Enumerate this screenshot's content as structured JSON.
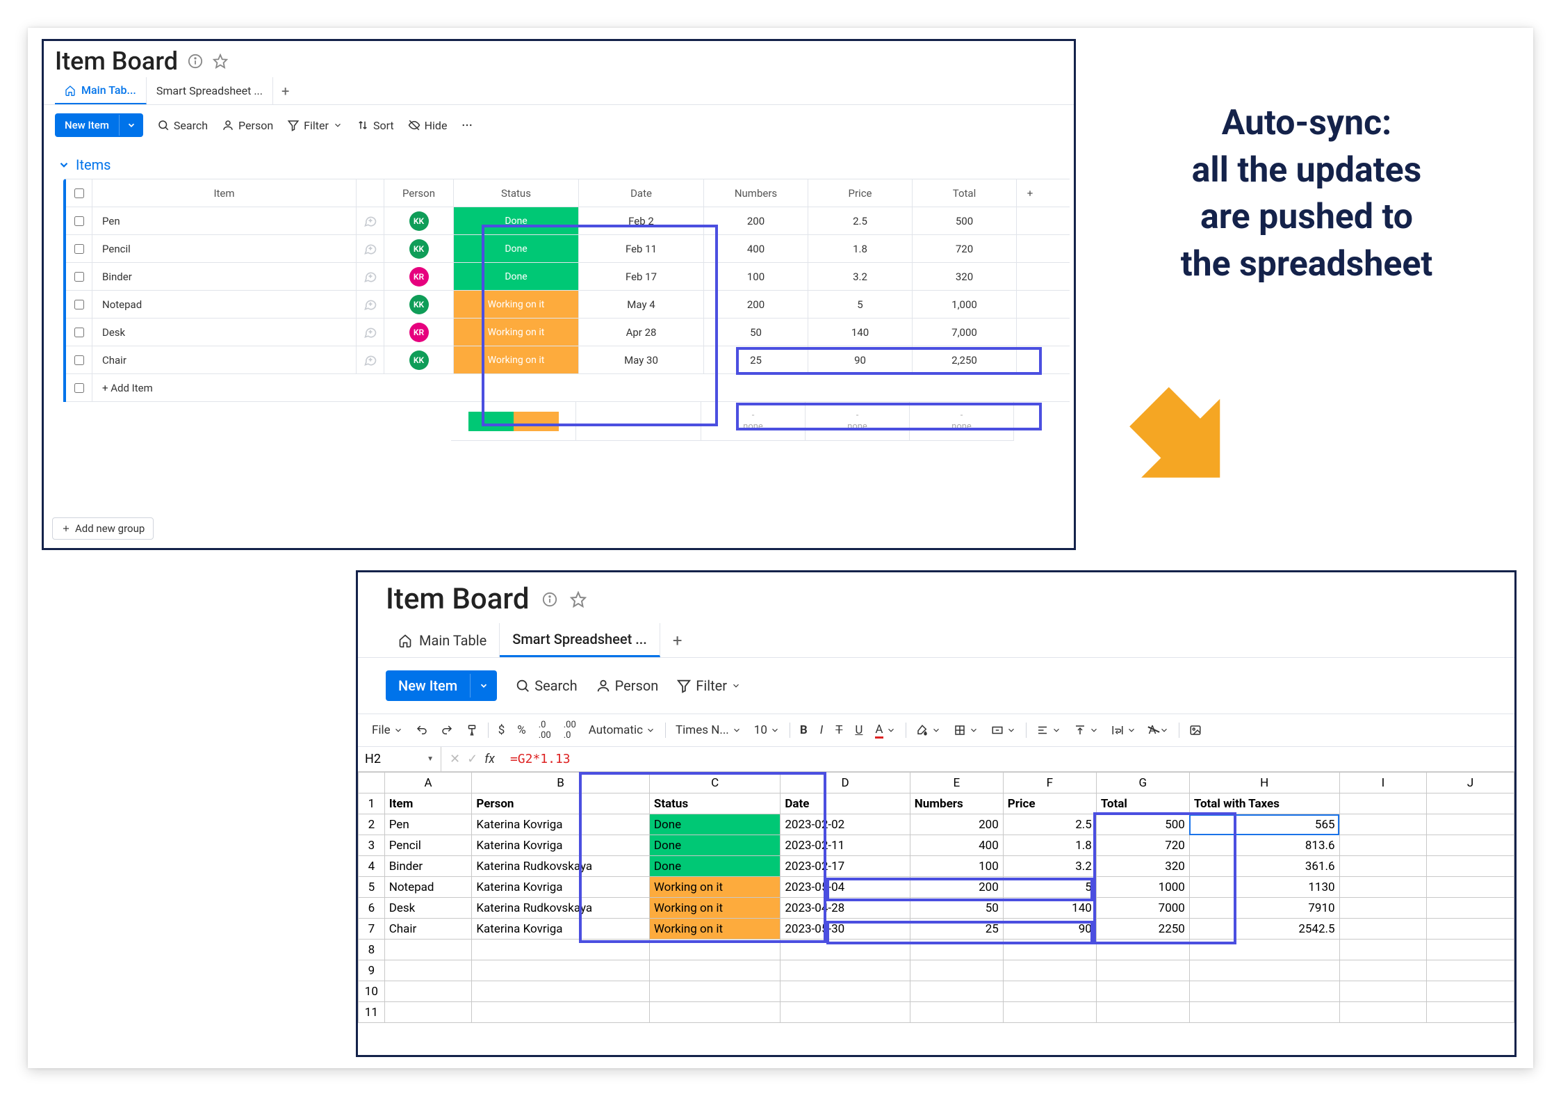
{
  "headline": "Auto-sync:\nall the updates\nare pushed to\nthe spreadsheet",
  "board": {
    "title": "Item Board",
    "tabs": {
      "main": "Main Tab...",
      "smart": "Smart Spreadsheet ..."
    },
    "new_item": "New Item",
    "toolbar": {
      "search": "Search",
      "person": "Person",
      "filter": "Filter",
      "sort": "Sort",
      "hide": "Hide"
    },
    "group_title": "Items",
    "columns": {
      "item": "Item",
      "person": "Person",
      "status": "Status",
      "date": "Date",
      "numbers": "Numbers",
      "price": "Price",
      "total": "Total"
    },
    "rows": [
      {
        "item": "Pen",
        "avatar": "KK",
        "avatarClass": "av-KK",
        "status": "Done",
        "statusClass": "st-done",
        "date": "Feb 2",
        "numbers": "200",
        "price": "2.5",
        "total": "500"
      },
      {
        "item": "Pencil",
        "avatar": "KK",
        "avatarClass": "av-KK",
        "status": "Done",
        "statusClass": "st-done",
        "date": "Feb 11",
        "numbers": "400",
        "price": "1.8",
        "total": "720"
      },
      {
        "item": "Binder",
        "avatar": "KR",
        "avatarClass": "av-KR",
        "status": "Done",
        "statusClass": "st-done",
        "date": "Feb 17",
        "numbers": "100",
        "price": "3.2",
        "total": "320"
      },
      {
        "item": "Notepad",
        "avatar": "KK",
        "avatarClass": "av-KK",
        "status": "Working on it",
        "statusClass": "st-wip",
        "date": "May 4",
        "numbers": "200",
        "price": "5",
        "total": "1,000"
      },
      {
        "item": "Desk",
        "avatar": "KR",
        "avatarClass": "av-KR",
        "status": "Working on it",
        "statusClass": "st-wip",
        "date": "Apr 28",
        "numbers": "50",
        "price": "140",
        "total": "7,000"
      },
      {
        "item": "Chair",
        "avatar": "KK",
        "avatarClass": "av-KK",
        "status": "Working on it",
        "statusClass": "st-wip",
        "date": "May 30",
        "numbers": "25",
        "price": "90",
        "total": "2,250"
      }
    ],
    "add_item": "+ Add Item",
    "summary_none": "-\nnone",
    "add_group": "Add new group"
  },
  "sheet": {
    "title": "Item Board",
    "tabs": {
      "main": "Main Table",
      "smart": "Smart Spreadsheet ..."
    },
    "new_item": "New Item",
    "toolbar": {
      "search": "Search",
      "person": "Person",
      "filter": "Filter"
    },
    "fmt": {
      "file": "File",
      "auto": "Automatic",
      "font": "Times N...",
      "size": "10"
    },
    "fx": {
      "cell": "H2",
      "formula": "=G2*1.13"
    },
    "col_letters": [
      "A",
      "B",
      "C",
      "D",
      "E",
      "F",
      "G",
      "H",
      "I",
      "J"
    ],
    "header_row": [
      "Item",
      "Person",
      "Status",
      "Date",
      "Numbers",
      "Price",
      "Total",
      "Total with Taxes",
      "",
      ""
    ],
    "rows": [
      {
        "n": 2,
        "cells": [
          "Pen",
          "Katerina Kovriga",
          "Done",
          "2023-02-02",
          "200",
          "2.5",
          "500",
          "565"
        ],
        "stClass": "st-done-cell",
        "taxClass": "tax1"
      },
      {
        "n": 3,
        "cells": [
          "Pencil",
          "Katerina Kovriga",
          "Done",
          "2023-02-11",
          "400",
          "1.8",
          "720",
          "813.6"
        ],
        "stClass": "st-done-cell",
        "taxClass": "tax2"
      },
      {
        "n": 4,
        "cells": [
          "Binder",
          "Katerina Rudkovskaya",
          "Done",
          "2023-02-17",
          "100",
          "3.2",
          "320",
          "361.6"
        ],
        "stClass": "st-done-cell",
        "taxClass": "tax3"
      },
      {
        "n": 5,
        "cells": [
          "Notepad",
          "Katerina Kovriga",
          "Working on it",
          "2023-05-04",
          "200",
          "5",
          "1000",
          "1130"
        ],
        "stClass": "st-wip-cell",
        "taxClass": "tax4"
      },
      {
        "n": 6,
        "cells": [
          "Desk",
          "Katerina Rudkovskaya",
          "Working on it",
          "2023-04-28",
          "50",
          "140",
          "7000",
          "7910"
        ],
        "stClass": "st-wip-cell",
        "taxClass": "tax5"
      },
      {
        "n": 7,
        "cells": [
          "Chair",
          "Katerina Kovriga",
          "Working on it",
          "2023-05-30",
          "25",
          "90",
          "2250",
          "2542.5"
        ],
        "stClass": "st-wip-cell",
        "taxClass": "tax6"
      }
    ],
    "empty_rows": [
      8,
      9,
      10,
      11
    ]
  }
}
